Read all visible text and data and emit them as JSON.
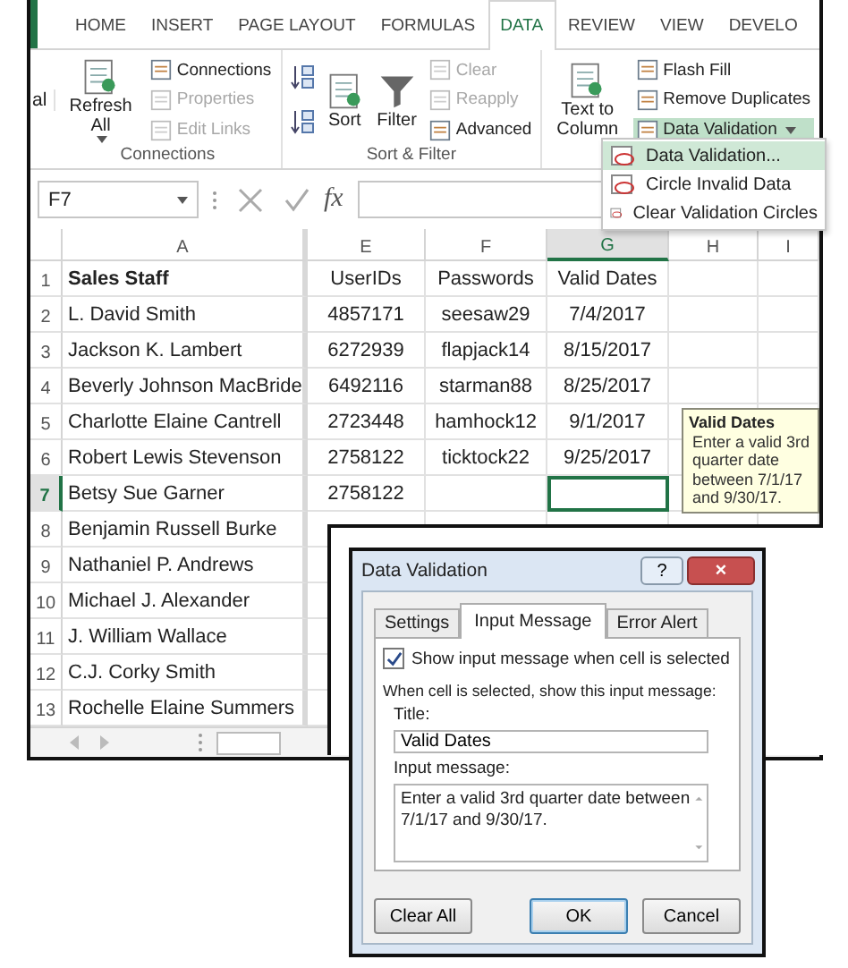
{
  "ribbon_tabs": [
    {
      "label": "HOME",
      "selected": false
    },
    {
      "label": "INSERT",
      "selected": false
    },
    {
      "label": "PAGE LAYOUT",
      "selected": false
    },
    {
      "label": "FORMULAS",
      "selected": false
    },
    {
      "label": "DATA",
      "selected": true
    },
    {
      "label": "REVIEW",
      "selected": false
    },
    {
      "label": "VIEW",
      "selected": false
    },
    {
      "label": "DEVELO",
      "selected": false
    }
  ],
  "ribbon_cut_label": "al",
  "ribbon_groups": [
    {
      "label": "Connections",
      "columns": [
        [
          {
            "kind": "large",
            "label": "Refresh All",
            "dropdown": true,
            "disabled": false
          }
        ],
        [
          {
            "kind": "small",
            "label": "Connections",
            "disabled": false
          },
          {
            "kind": "small",
            "label": "Properties",
            "disabled": true
          },
          {
            "kind": "small",
            "label": "Edit Links",
            "disabled": true
          }
        ]
      ]
    },
    {
      "label": "Sort & Filter",
      "columns": [
        [
          {
            "kind": "sort",
            "disabled": false
          },
          {
            "kind": "sort",
            "disabled": false
          }
        ],
        [
          {
            "kind": "large",
            "label": "Sort",
            "dropdown": false,
            "disabled": false
          }
        ],
        [
          {
            "kind": "filter",
            "label": "Filter",
            "disabled": false
          }
        ],
        [
          {
            "kind": "small",
            "label": "Clear",
            "disabled": true
          },
          {
            "kind": "small",
            "label": "Reapply",
            "disabled": true
          },
          {
            "kind": "small",
            "label": "Advanced",
            "disabled": false
          }
        ]
      ]
    },
    {
      "columns": [
        [
          {
            "kind": "large",
            "label": "Text to Column",
            "dropdown": false,
            "disabled": false
          }
        ],
        [
          {
            "kind": "small",
            "label": "Flash Fill",
            "disabled": false
          },
          {
            "kind": "small",
            "label": "Remove Duplicates",
            "disabled": false
          },
          {
            "kind": "small",
            "label": "Data Validation",
            "disabled": false,
            "dropdown": true,
            "selected": true
          }
        ]
      ]
    }
  ],
  "name_box": "F7",
  "function_label": "fx",
  "validation_menu": [
    {
      "label": "Data Validation...",
      "selected": true
    },
    {
      "label": "Circle Invalid Data",
      "selected": false
    },
    {
      "label": "Clear Validation Circles",
      "selected": false
    }
  ],
  "columns": [
    {
      "label": "A",
      "selected": false
    },
    {
      "label": "E",
      "selected": false
    },
    {
      "label": "F",
      "selected": false
    },
    {
      "label": "G",
      "selected": true
    },
    {
      "label": "H",
      "selected": false
    },
    {
      "label": "I",
      "selected": false
    }
  ],
  "rows": [
    {
      "number": "1",
      "header": true,
      "selected": false,
      "cells": [
        "Sales Staff",
        "UserIDs",
        "Passwords",
        "Valid Dates"
      ]
    },
    {
      "number": "2",
      "header": false,
      "selected": false,
      "cells": [
        "L. David Smith",
        "4857171",
        "seesaw29",
        "7/4/2017"
      ]
    },
    {
      "number": "3",
      "header": false,
      "selected": false,
      "cells": [
        "Jackson K. Lambert",
        "6272939",
        "flapjack14",
        "8/15/2017"
      ]
    },
    {
      "number": "4",
      "header": false,
      "selected": false,
      "cells": [
        "Beverly Johnson MacBride",
        "6492116",
        "starman88",
        "8/25/2017"
      ]
    },
    {
      "number": "5",
      "header": false,
      "selected": false,
      "cells": [
        "Charlotte Elaine Cantrell",
        "2723448",
        "hamhock12",
        "9/1/2017"
      ]
    },
    {
      "number": "6",
      "header": false,
      "selected": false,
      "cells": [
        "Robert Lewis Stevenson",
        "2758122",
        "ticktock22",
        "9/25/2017"
      ]
    },
    {
      "number": "7",
      "header": false,
      "selected": true,
      "cells": [
        "Betsy Sue Garner",
        "2758122"
      ]
    },
    {
      "number": "8",
      "header": false,
      "selected": false,
      "cells": [
        "Benjamin Russell Burke"
      ]
    },
    {
      "number": "9",
      "header": false,
      "selected": false,
      "cells": [
        "Nathaniel P. Andrews"
      ]
    },
    {
      "number": "10",
      "header": false,
      "selected": false,
      "cells": [
        "Michael J. Alexander"
      ]
    },
    {
      "number": "11",
      "header": false,
      "selected": false,
      "cells": [
        "J. William Wallace"
      ]
    },
    {
      "number": "12",
      "header": false,
      "selected": false,
      "cells": [
        "C.J. Corky Smith"
      ]
    },
    {
      "number": "13",
      "header": false,
      "selected": false,
      "cells": [
        "Rochelle Elaine Summers"
      ]
    }
  ],
  "tooltip": {
    "title": "Valid Dates",
    "text": "Enter a valid 3rd quarter date between 7/1/17 and 9/30/17."
  },
  "dialog": {
    "title": "Data Validation",
    "help_button": "?",
    "close_button": "×",
    "tabs": [
      {
        "label": "Settings",
        "selected": false
      },
      {
        "label": "Input Message",
        "selected": true
      },
      {
        "label": "Error Alert",
        "selected": false
      }
    ],
    "show_message": {
      "label": "Show input message when cell is selected",
      "checked": true
    },
    "instruction": "When cell is selected, show this input message:",
    "title_label": "Title:",
    "title_value": "Valid Dates",
    "message_label": "Input message:",
    "message_value": "Enter a valid 3rd quarter date between 7/1/17 and 9/30/17.",
    "buttons": [
      {
        "label": "Clear All",
        "default": false
      },
      {
        "label": "OK",
        "default": true
      },
      {
        "label": "Cancel",
        "default": false
      }
    ]
  }
}
